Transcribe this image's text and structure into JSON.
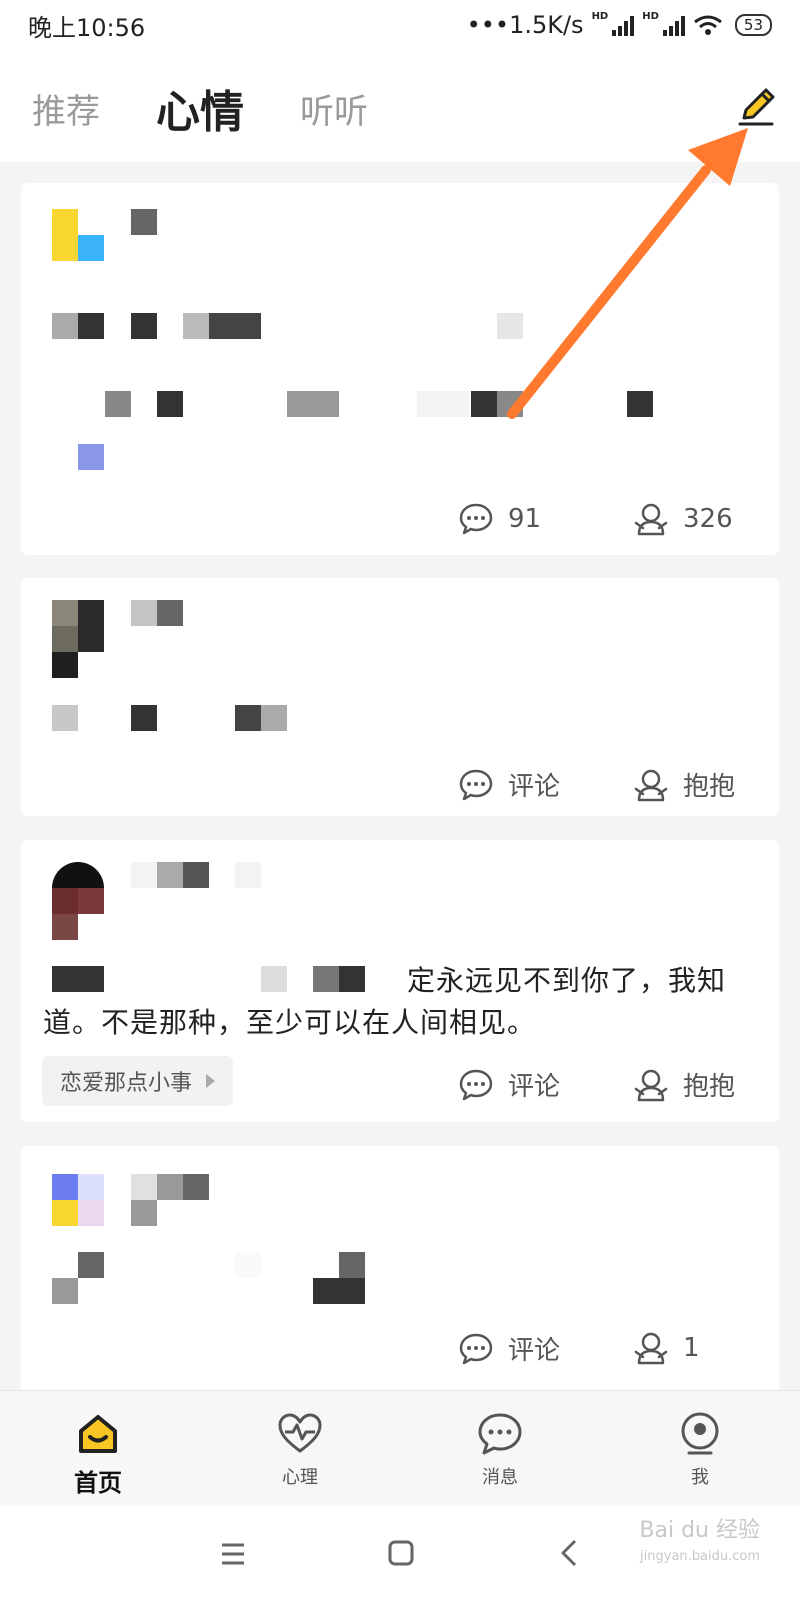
{
  "status_bar": {
    "time": "晚上10:56",
    "net_speed": "•••1.5K/s",
    "hd_label": "HD",
    "battery": "53"
  },
  "header": {
    "tabs": [
      {
        "label": "推荐",
        "active": false
      },
      {
        "label": "心情",
        "active": true
      },
      {
        "label": "听听",
        "active": false
      }
    ],
    "compose_icon": "pencil-icon"
  },
  "posts": [
    {
      "comment_label": "91",
      "hug_label": "326"
    },
    {
      "comment_label": "评论",
      "hug_label": "抱抱"
    },
    {
      "text": "定永远见不到你了，我知道。不是那种，至少可以在人间相见。",
      "topic": "恋爱那点小事",
      "comment_label": "评论",
      "hug_label": "抱抱"
    },
    {
      "comment_label": "评论",
      "hug_label": "1"
    }
  ],
  "bottom_nav": [
    {
      "label": "首页",
      "icon": "home-icon",
      "active": true
    },
    {
      "label": "心理",
      "icon": "heart-pulse-icon",
      "active": false
    },
    {
      "label": "消息",
      "icon": "chat-icon",
      "active": false
    },
    {
      "label": "我",
      "icon": "face-icon",
      "active": false
    }
  ],
  "watermark": {
    "line1": "Bai du 经验",
    "line2": "jingyan.baidu.com"
  },
  "colors": {
    "accent": "#F9C623",
    "arrow": "#FF7A2F",
    "text_primary": "#222222",
    "text_secondary": "#9A9A9A"
  }
}
